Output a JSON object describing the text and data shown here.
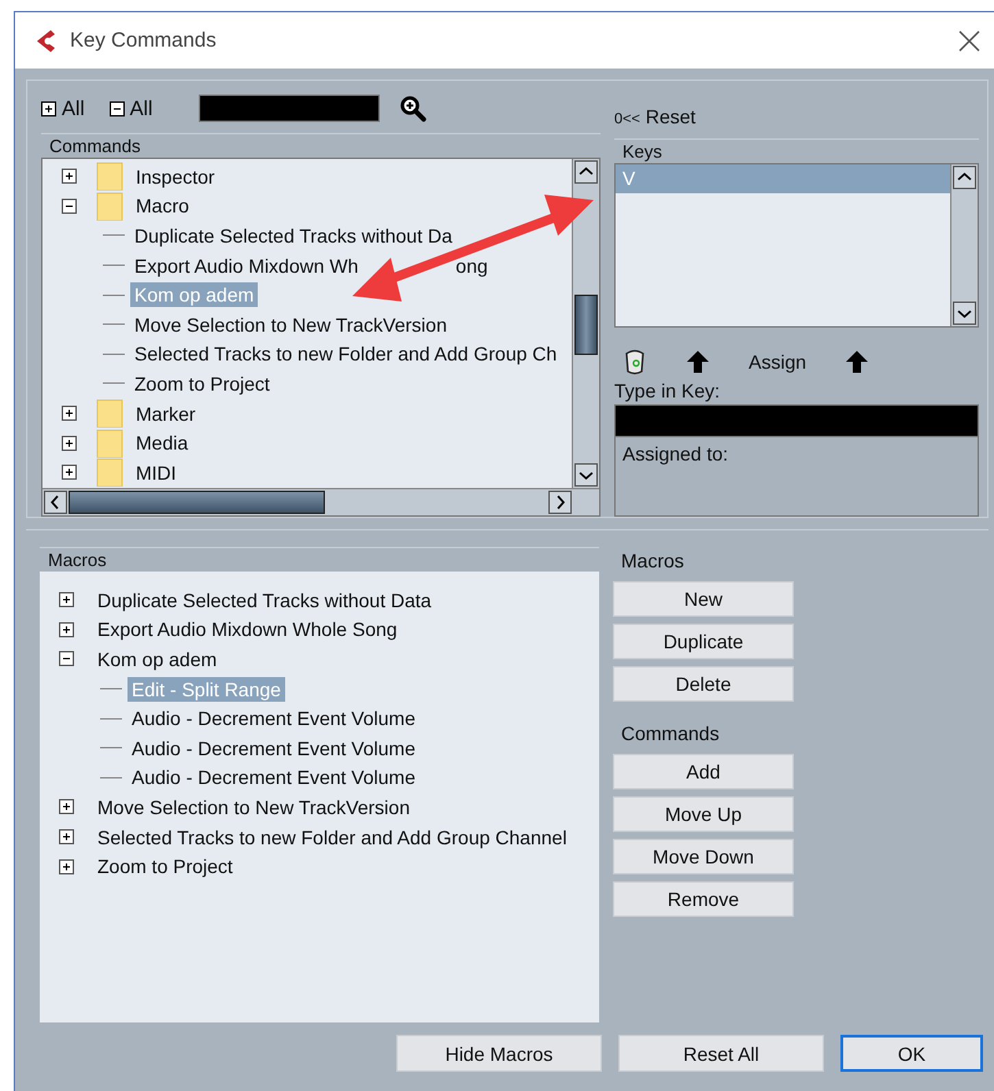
{
  "window": {
    "title": "Key Commands"
  },
  "toolbar": {
    "expand_all": "All",
    "collapse_all": "All"
  },
  "reset": {
    "glyph": "0<<",
    "label": "Reset"
  },
  "commands": {
    "header": "Commands",
    "items": [
      {
        "label": "Inspector",
        "selected": false,
        "expanded": false
      },
      {
        "label": "Macro",
        "selected": false,
        "expanded": true,
        "children": [
          {
            "label": "Duplicate Selected Tracks without Da",
            "selected": false
          },
          {
            "label": "Export Audio Mixdown Wh",
            "tail": "ong",
            "selected": false
          },
          {
            "label": "Kom op adem",
            "selected": true
          },
          {
            "label": "Move Selection to New TrackVersion",
            "selected": false
          },
          {
            "label": "Selected Tracks to new Folder and Add Group Ch",
            "selected": false
          },
          {
            "label": "Zoom to Project",
            "selected": false
          }
        ]
      },
      {
        "label": "Marker",
        "selected": false,
        "expanded": false
      },
      {
        "label": "Media",
        "selected": false,
        "expanded": false
      },
      {
        "label": "MIDI",
        "selected": false,
        "expanded": false
      }
    ]
  },
  "keys": {
    "header": "Keys",
    "items": [
      {
        "label": "V",
        "selected": true
      }
    ]
  },
  "assign": {
    "label": "Assign"
  },
  "type_in_key": {
    "label": "Type in Key:"
  },
  "assigned_to": {
    "label": "Assigned to:"
  },
  "macros": {
    "header": "Macros",
    "items": [
      {
        "label": "Duplicate Selected Tracks without Data",
        "selected": false,
        "expanded": false
      },
      {
        "label": "Export Audio Mixdown Whole Song",
        "selected": false,
        "expanded": false
      },
      {
        "label": "Kom op adem",
        "selected": false,
        "expanded": true,
        "children": [
          {
            "label": "Edit - Split Range",
            "selected": true
          },
          {
            "label": "Audio - Decrement Event Volume",
            "selected": false
          },
          {
            "label": "Audio - Decrement Event Volume",
            "selected": false
          },
          {
            "label": "Audio - Decrement Event Volume",
            "selected": false
          }
        ]
      },
      {
        "label": "Move Selection to New TrackVersion",
        "selected": false,
        "expanded": false
      },
      {
        "label": "Selected Tracks to new Folder and Add Group Channel",
        "selected": false,
        "expanded": false
      },
      {
        "label": "Zoom to Project",
        "selected": false,
        "expanded": false
      }
    ]
  },
  "macro_buttons": {
    "title": "Macros",
    "buttons": [
      "New",
      "Duplicate",
      "Delete"
    ]
  },
  "command_buttons": {
    "title": "Commands",
    "buttons": [
      "Add",
      "Move Up",
      "Move Down",
      "Remove"
    ]
  },
  "footer": [
    {
      "label": "Hide Macros",
      "focused": false
    },
    {
      "label": "Reset All",
      "focused": false
    },
    {
      "label": "OK",
      "focused": true
    }
  ]
}
